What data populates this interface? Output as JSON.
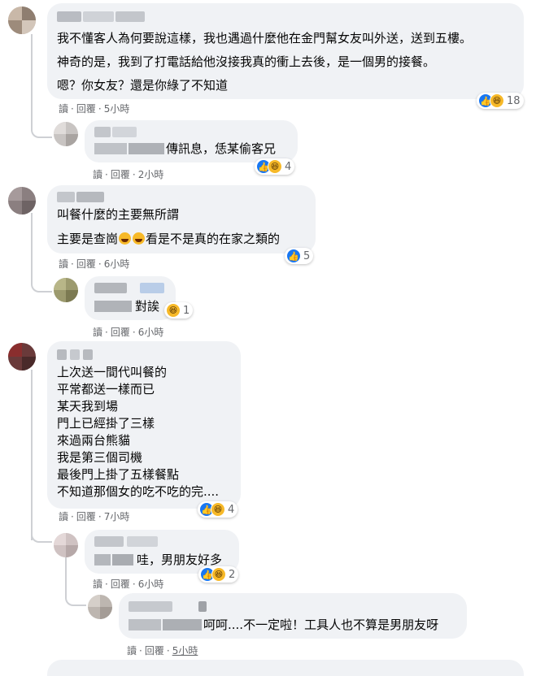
{
  "comments": [
    {
      "id": "c1",
      "lines": [
        "我不懂客人為何要說這樣，我也遇過什麼他在金門幫女友叫外送，送到五樓。",
        "神奇的是，我到了打電話給他沒接我真的衝上去後，是一個男的接餐。",
        "嗯？你女友？還是你綠了不知道"
      ],
      "actions": {
        "read": "讀",
        "reply": "回覆",
        "time": "5小時"
      },
      "reactions": {
        "icons": [
          "like-icon",
          "haha-icon"
        ],
        "count": "18"
      }
    },
    {
      "id": "c2",
      "lines": [
        "傳訊息，恁某偷客兄"
      ],
      "actions": {
        "read": "讀",
        "reply": "回覆",
        "time": "2小時"
      },
      "reactions": {
        "icons": [
          "like-icon",
          "haha-icon"
        ],
        "count": "4"
      }
    },
    {
      "id": "c3",
      "lines": [
        "叫餐什麼的主要無所謂",
        "主要是查崗",
        "看是不是真的在家之類的"
      ],
      "actions": {
        "read": "讀",
        "reply": "回覆",
        "time": "6小時"
      },
      "reactions": {
        "icons": [
          "like-icon"
        ],
        "count": "5"
      }
    },
    {
      "id": "c4",
      "lines": [
        "對誒"
      ],
      "actions": {
        "read": "讀",
        "reply": "回覆",
        "time": "6小時"
      },
      "reactions": {
        "icons": [
          "haha-icon"
        ],
        "count": "1"
      }
    },
    {
      "id": "c5",
      "lines": [
        "上次送一間代叫餐的",
        "平常都送一樣而已",
        "某天我到場",
        "門上已經掛了三樣",
        "來過兩台熊貓",
        "我是第三個司機",
        "最後門上掛了五樣餐點",
        "不知道那個女的吃不吃的完...."
      ],
      "actions": {
        "read": "讀",
        "reply": "回覆",
        "time": "7小時"
      },
      "reactions": {
        "icons": [
          "like-icon",
          "haha-icon"
        ],
        "count": "4"
      }
    },
    {
      "id": "c6",
      "lines": [
        "哇，男朋友好多"
      ],
      "actions": {
        "read": "讀",
        "reply": "回覆",
        "time": "6小時"
      },
      "reactions": {
        "icons": [
          "like-icon",
          "haha-icon"
        ],
        "count": "2"
      }
    },
    {
      "id": "c7",
      "lines": [
        "呵呵....不一定啦！工具人也不算是男朋友呀"
      ],
      "actions": {
        "read": "讀",
        "reply": "回覆",
        "time": "5小時"
      },
      "reactions": {
        "icons": [],
        "count": ""
      }
    }
  ]
}
